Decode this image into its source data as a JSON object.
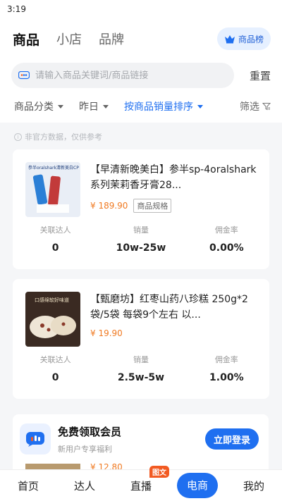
{
  "status_bar": {
    "time": "3:19"
  },
  "tabs": [
    {
      "label": "商品",
      "active": true
    },
    {
      "label": "小店",
      "active": false
    },
    {
      "label": "品牌",
      "active": false
    }
  ],
  "rank_button": {
    "label": "商品榜",
    "icon": "crown-icon"
  },
  "search": {
    "placeholder": "请输入商品关键词/商品链接",
    "reset_label": "重置"
  },
  "filters": [
    {
      "label": "商品分类",
      "active": false
    },
    {
      "label": "昨日",
      "active": false
    },
    {
      "label": "按商品销量排序",
      "active": true
    }
  ],
  "screen_label": "筛选",
  "notice": "非官方数据，仅供参考",
  "stat_labels": [
    "关联达人",
    "销量",
    "佣金率"
  ],
  "products": [
    {
      "title": "【早清新晚美白】参半sp-4oralshark系列茉莉香牙膏28...",
      "price": "¥ 189.90",
      "tag": "商品规格",
      "thumb_text": "参半oralshark清新美白CP",
      "stats": [
        "0",
        "10w-25w",
        "0.00%"
      ]
    },
    {
      "title": "【甄磨坊】红枣山药八珍糕 250g*2袋/5袋 每袋9个左右 以...",
      "price": "¥ 19.90",
      "tag": "",
      "thumb_text": "口感绵软好味道",
      "stats": [
        "0",
        "2.5w-5w",
        "1.00%"
      ]
    }
  ],
  "peek_price": "¥ 12.80",
  "login_banner": {
    "title": "免费领取会员",
    "subtitle": "新用户专享福利",
    "button": "立即登录"
  },
  "bottom_nav": [
    {
      "label": "首页",
      "active": false
    },
    {
      "label": "达人",
      "active": false
    },
    {
      "label": "直播",
      "active": false,
      "badge": "图文"
    },
    {
      "label": "电商",
      "active": true
    },
    {
      "label": "我的",
      "active": false
    }
  ],
  "colors": {
    "accent": "#1f6ff0",
    "price": "#f07a22",
    "badge": "#f25a22"
  }
}
